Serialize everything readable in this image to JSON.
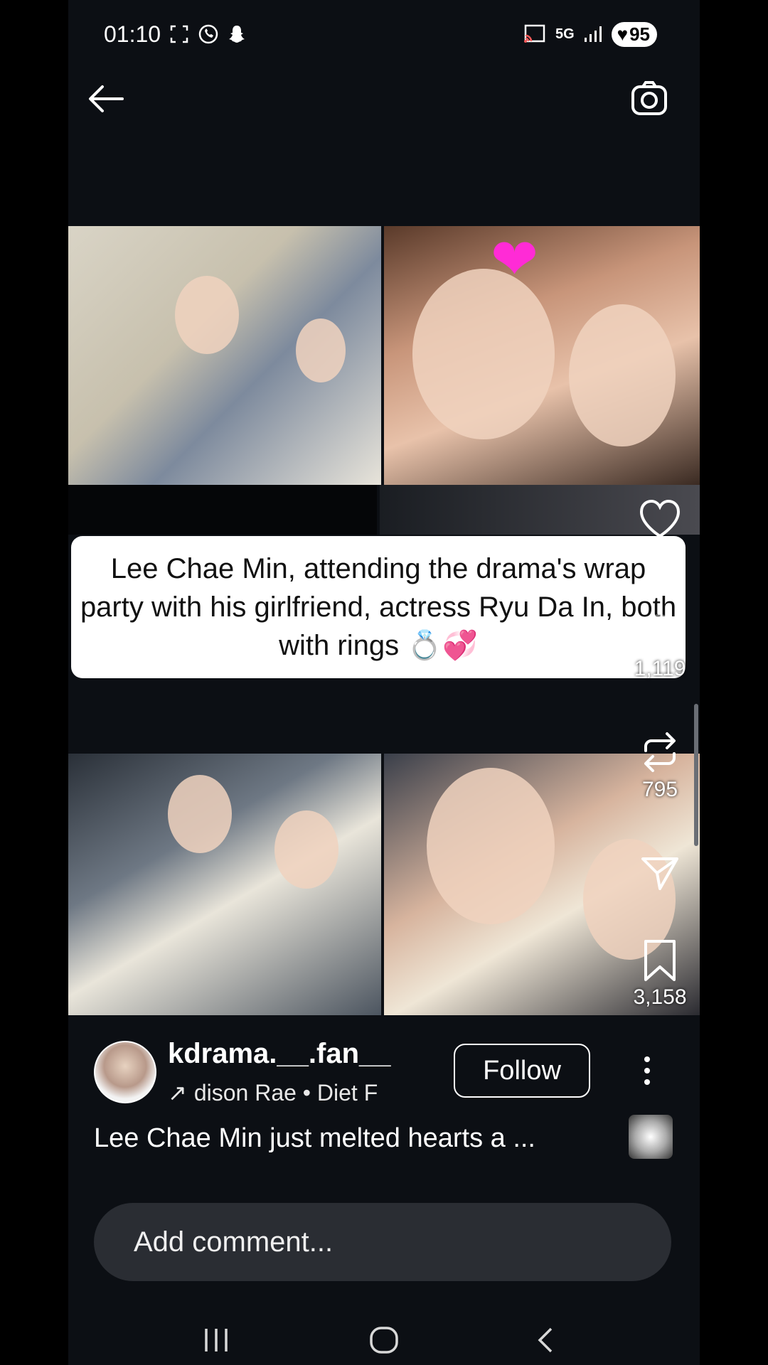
{
  "status_bar": {
    "time": "01:10",
    "network": "5G",
    "battery": "95"
  },
  "post": {
    "caption_card_text": "Lee Chae Min, attending the drama's wrap party with his girlfriend, actress Ryu Da In, both with rings 💍💞",
    "heart_glyph": "❤"
  },
  "actions": {
    "comment_count": "1,119",
    "repost_count": "795",
    "save_count": "3,158"
  },
  "author": {
    "username": "kdrama.__.fan__",
    "audio_arrow": "↗",
    "audio_text": "dison Rae • Diet F",
    "follow_label": "Follow"
  },
  "caption": {
    "text": "Lee Chae Min just melted hearts a ..."
  },
  "comment": {
    "placeholder": "Add comment..."
  },
  "colors": {
    "background": "#0c0f14",
    "comment_box": "#2a2d33",
    "heart_deco": "#ff2bd6"
  }
}
